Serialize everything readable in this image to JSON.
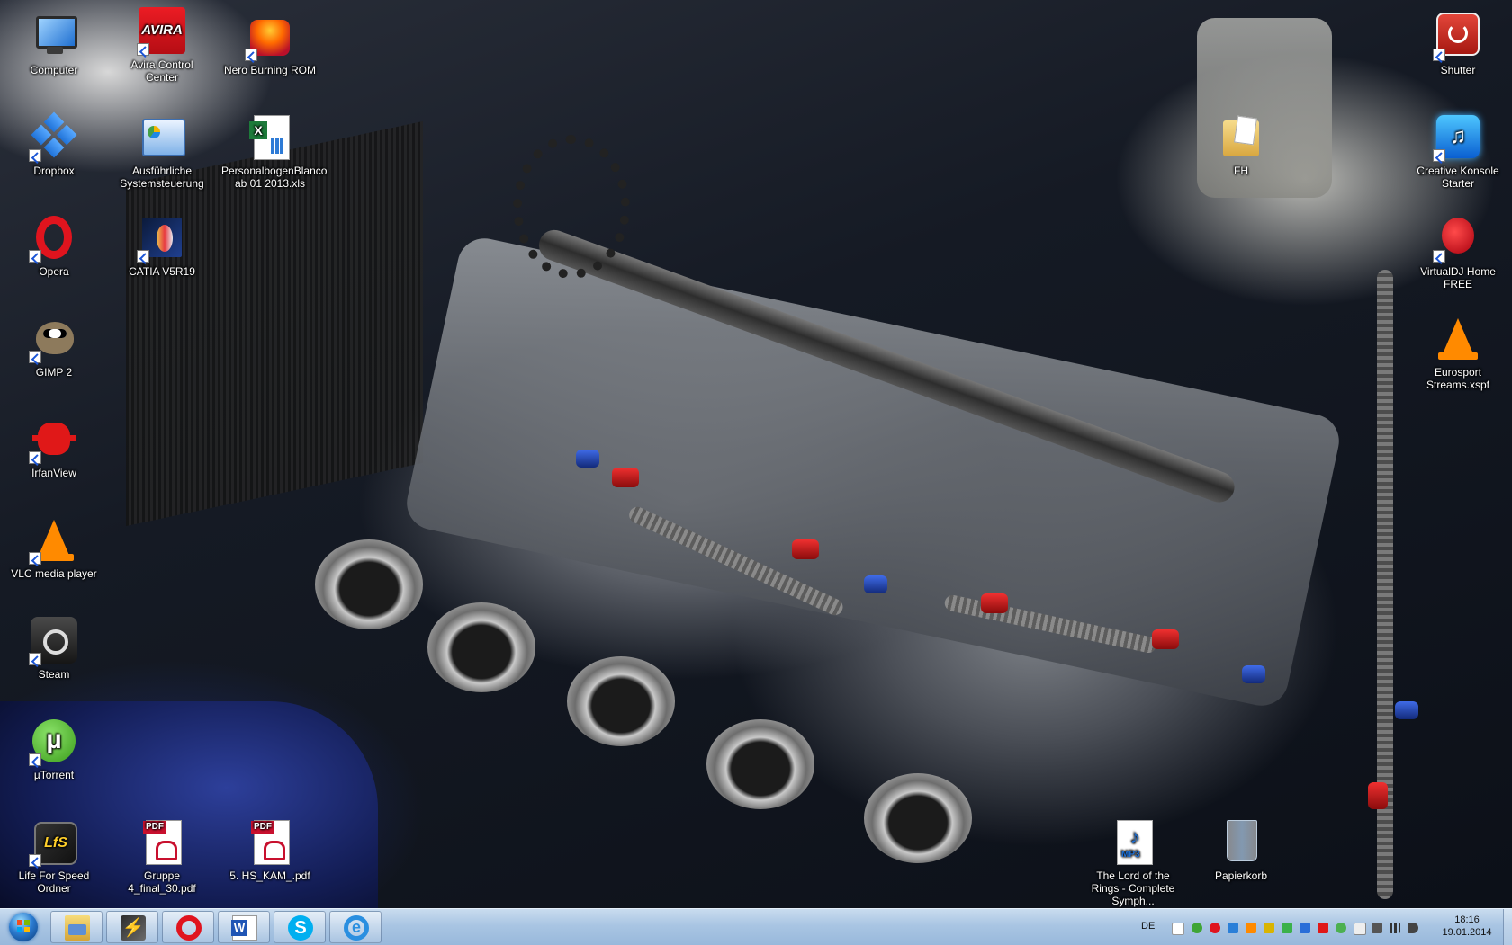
{
  "desktop": {
    "icons": [
      {
        "id": "computer",
        "label": "Computer"
      },
      {
        "id": "avira",
        "label": "Avira Control Center"
      },
      {
        "id": "nero",
        "label": "Nero Burning ROM"
      },
      {
        "id": "dropbox",
        "label": "Dropbox"
      },
      {
        "id": "cpanel",
        "label": "Ausführliche Systemsteuerung"
      },
      {
        "id": "excel",
        "label": "PersonalbogenBlanco ab 01 2013.xls"
      },
      {
        "id": "opera",
        "label": "Opera"
      },
      {
        "id": "catia",
        "label": "CATIA V5R19"
      },
      {
        "id": "gimp",
        "label": "GIMP 2"
      },
      {
        "id": "irfan",
        "label": "IrfanView"
      },
      {
        "id": "vlc",
        "label": "VLC media player"
      },
      {
        "id": "steam",
        "label": "Steam"
      },
      {
        "id": "utorrent",
        "label": "µTorrent"
      },
      {
        "id": "lfs",
        "label": "Life For Speed Ordner"
      },
      {
        "id": "pdf1",
        "label": "Gruppe 4_final_30.pdf"
      },
      {
        "id": "pdf2",
        "label": "5. HS_KAM_.pdf"
      },
      {
        "id": "fh",
        "label": "FH"
      },
      {
        "id": "shutter",
        "label": "Shutter"
      },
      {
        "id": "creative",
        "label": "Creative Konsole Starter"
      },
      {
        "id": "vdj",
        "label": "VirtualDJ Home FREE"
      },
      {
        "id": "eurosport",
        "label": "Eurosport Streams.xspf"
      },
      {
        "id": "mp3",
        "label": "The Lord of the Rings - Complete Symph..."
      },
      {
        "id": "bin",
        "label": "Papierkorb"
      }
    ]
  },
  "taskbar": {
    "pinned": [
      {
        "id": "explorer",
        "icon": "folder-icon"
      },
      {
        "id": "winamp",
        "icon": "winamp-icon"
      },
      {
        "id": "opera",
        "icon": "opera-icon"
      },
      {
        "id": "word",
        "icon": "word-icon"
      },
      {
        "id": "skype",
        "icon": "skype-icon"
      },
      {
        "id": "ie",
        "icon": "internet-explorer-icon"
      }
    ],
    "language": "DE",
    "clock": {
      "time": "18:16",
      "date": "19.01.2014"
    }
  },
  "colors": {
    "taskbar_top": "#c9dcef",
    "taskbar_bottom": "#98b8db",
    "label_text": "#ffffff"
  }
}
